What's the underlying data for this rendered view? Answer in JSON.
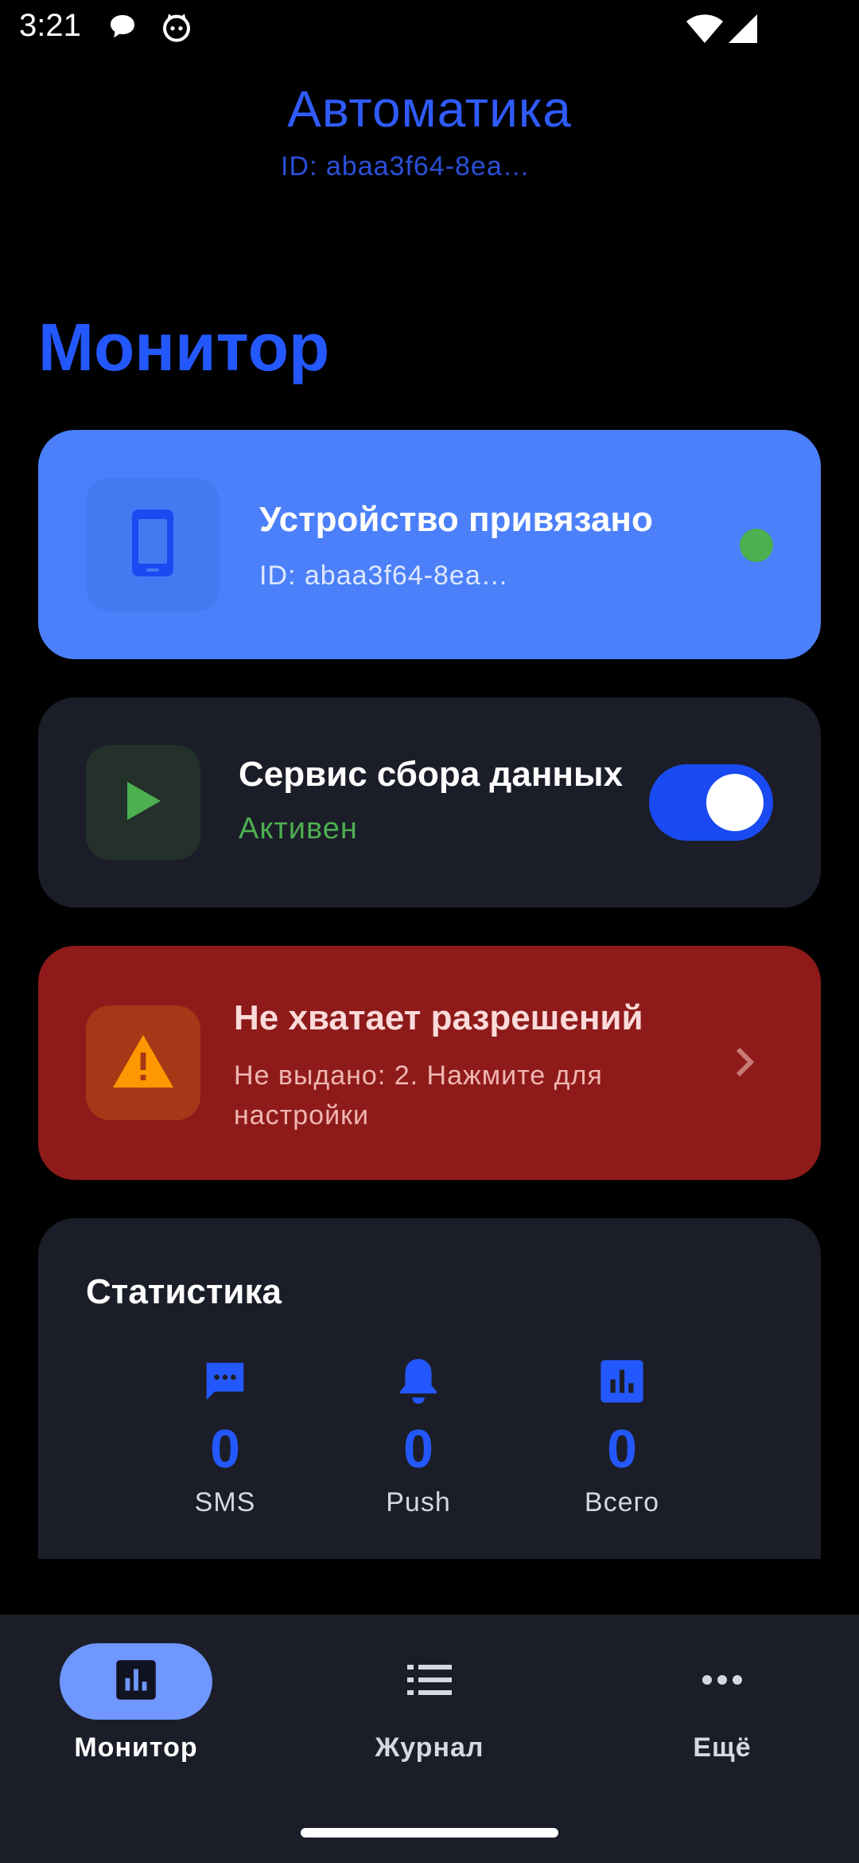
{
  "status_bar": {
    "time": "3:21",
    "icons": [
      "chat-bubble-icon",
      "cat-icon",
      "wifi-icon",
      "signal-icon"
    ]
  },
  "app_bar": {
    "title": "Автоматика",
    "subtitle": "ID: abaa3f64-8ea…"
  },
  "page": {
    "title": "Монитор"
  },
  "device_card": {
    "icon": "phone-icon",
    "title": "Устройство привязано",
    "id_text": "ID: abaa3f64-8ea…",
    "status_color": "#4caf50"
  },
  "service_card": {
    "icon": "play-icon",
    "title": "Сервис сбора данных",
    "status": "Активен",
    "toggle_on": true
  },
  "permissions_card": {
    "icon": "warning-icon",
    "title": "Не хватает разрешений",
    "description": "Не выдано: 2. Нажмите для настройки"
  },
  "stats_card": {
    "title": "Статистика",
    "items": [
      {
        "icon": "message-icon",
        "value": "0",
        "label": "SMS"
      },
      {
        "icon": "bell-icon",
        "value": "0",
        "label": "Push"
      },
      {
        "icon": "bar-chart-icon",
        "value": "0",
        "label": "Всего"
      }
    ]
  },
  "bottom_nav": {
    "items": [
      {
        "icon": "bar-chart-icon",
        "label": "Монитор",
        "active": true
      },
      {
        "icon": "list-icon",
        "label": "Журнал",
        "active": false
      },
      {
        "icon": "more-horizontal-icon",
        "label": "Ещё",
        "active": false
      }
    ]
  },
  "colors": {
    "accent": "#2458ff",
    "device_card": "#4b80fa",
    "card_dark": "#1b1e29",
    "danger_card": "#8e1b1a",
    "success": "#4caf50",
    "warning": "#ff9800"
  }
}
